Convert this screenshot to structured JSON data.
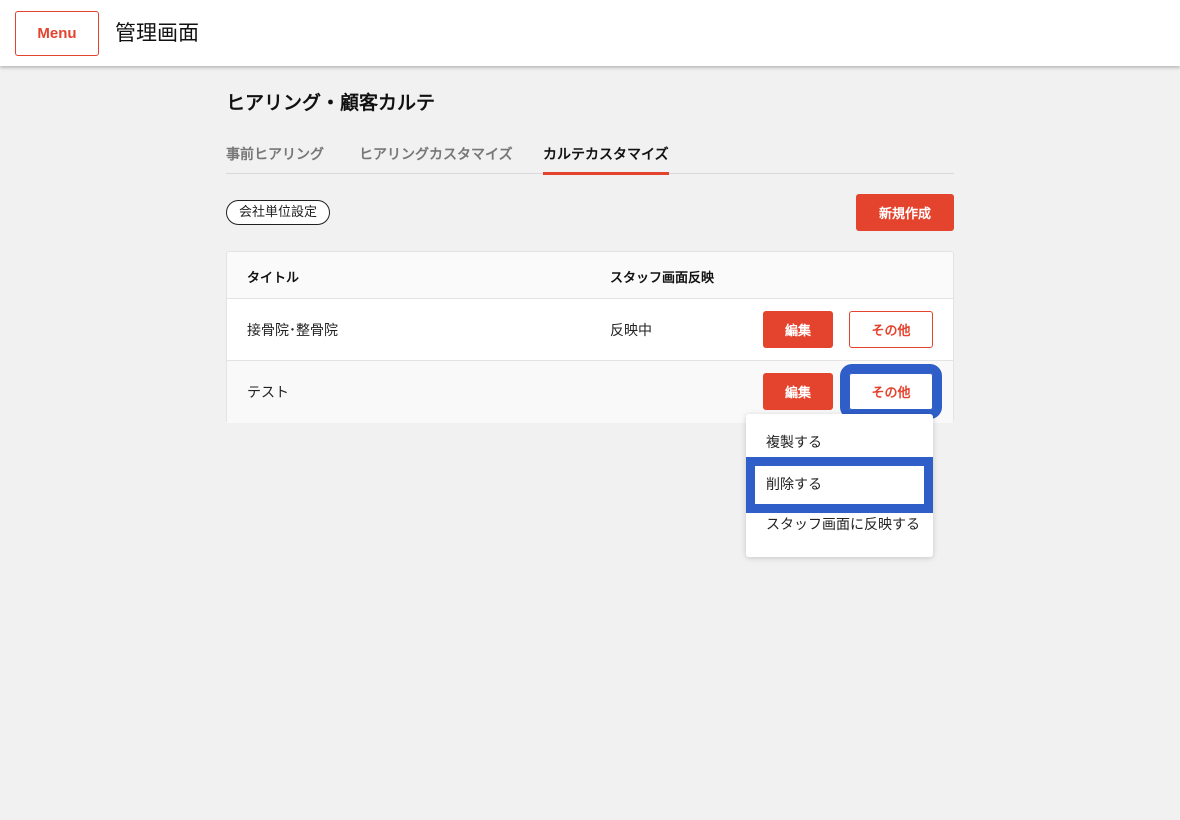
{
  "header": {
    "menu_label": "Menu",
    "title": "管理画面"
  },
  "page": {
    "title": "ヒアリング・顧客カルテ",
    "tabs": [
      {
        "label": "事前ヒアリング",
        "active": false
      },
      {
        "label": "ヒアリングカスタマイズ",
        "active": false
      },
      {
        "label": "カルテカスタマイズ",
        "active": true
      }
    ],
    "scope_badge": "会社単位設定",
    "new_button": "新規作成"
  },
  "table": {
    "columns": [
      "タイトル",
      "スタッフ画面反映"
    ],
    "rows": [
      {
        "title": "接骨院･整骨院",
        "status": "反映中",
        "edit": "編集",
        "other": "その他"
      },
      {
        "title": "テスト",
        "status": "",
        "edit": "編集",
        "other": "その他"
      }
    ]
  },
  "dropdown": {
    "items": [
      "複製する",
      "削除する",
      "スタッフ画面に反映する"
    ]
  },
  "colors": {
    "accent": "#e4432d",
    "focus_highlight": "#2f5ec8",
    "background": "#f1f1f1"
  }
}
